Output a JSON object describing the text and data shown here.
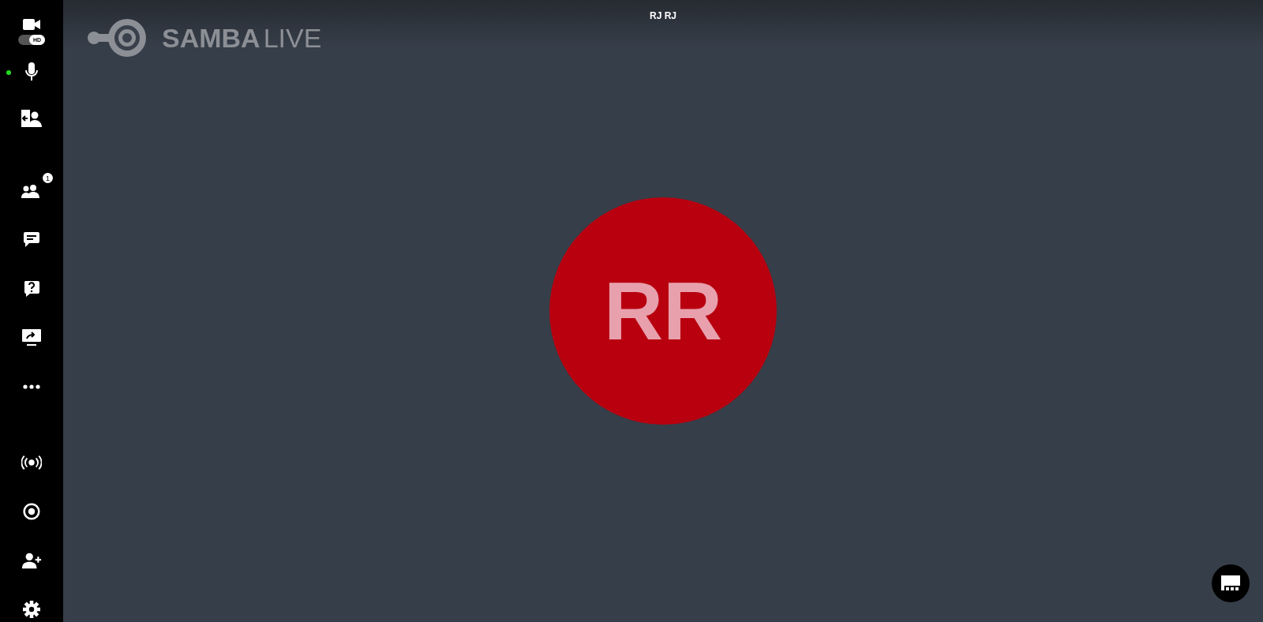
{
  "sidebar": {
    "camera": {
      "hd_label": "HD",
      "hd_on": true
    },
    "microphone": {
      "active": true
    },
    "groups": [
      [
        {
          "kind": "switch-view"
        }
      ],
      [
        {
          "kind": "participants",
          "badge": "1"
        },
        {
          "kind": "chat"
        },
        {
          "kind": "question"
        },
        {
          "kind": "share-screen"
        },
        {
          "kind": "more"
        }
      ],
      [
        {
          "kind": "broadcast"
        },
        {
          "kind": "record"
        },
        {
          "kind": "add-user"
        },
        {
          "kind": "settings"
        }
      ]
    ]
  },
  "logo": {
    "brand": "SAMBA",
    "product": "LIVE"
  },
  "stage": {
    "title": "RJ RJ",
    "avatar": {
      "initials": "RR",
      "color": "#b8000f"
    }
  },
  "captions_button": true
}
